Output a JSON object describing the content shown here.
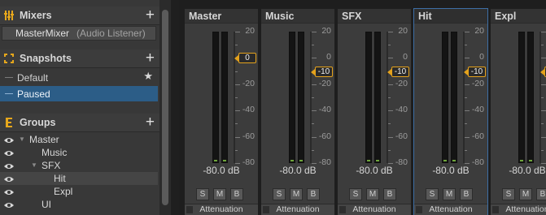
{
  "mixers": {
    "title": "Mixers",
    "items": [
      {
        "name": "MasterMixer",
        "sub": "(Audio Listener)"
      }
    ]
  },
  "snapshots": {
    "title": "Snapshots",
    "items": [
      {
        "label": "Default",
        "starred": true
      },
      {
        "label": "Paused",
        "selected": true
      }
    ]
  },
  "groups": {
    "title": "Groups",
    "items": [
      "Master",
      "Music",
      "SFX",
      "Hit",
      "Expl",
      "UI"
    ]
  },
  "scale": [
    "20",
    "0",
    "-20",
    "-40",
    "-60",
    "-80"
  ],
  "strips": [
    {
      "name": "Master",
      "level": "-80.0 dB",
      "handle": "0",
      "attenuation": "Attenuation"
    },
    {
      "name": "Music",
      "level": "-80.0 dB",
      "handle": "-10",
      "attenuation": "Attenuation"
    },
    {
      "name": "SFX",
      "level": "-80.0 dB",
      "handle": "-10",
      "attenuation": "Attenuation"
    },
    {
      "name": "Hit",
      "level": "-80.0 dB",
      "handle": "-10",
      "attenuation": "Attenuation"
    },
    {
      "name": "Expl",
      "level": "-80.0 dB",
      "handle": "-10",
      "attenuation": "Attenuation"
    }
  ],
  "buttons": {
    "solo": "S",
    "mute": "M",
    "bypass": "B"
  },
  "colors": {
    "accent": "#e4a21c",
    "selection": "#2c5d87",
    "meter_floor": "#6fa53b"
  }
}
